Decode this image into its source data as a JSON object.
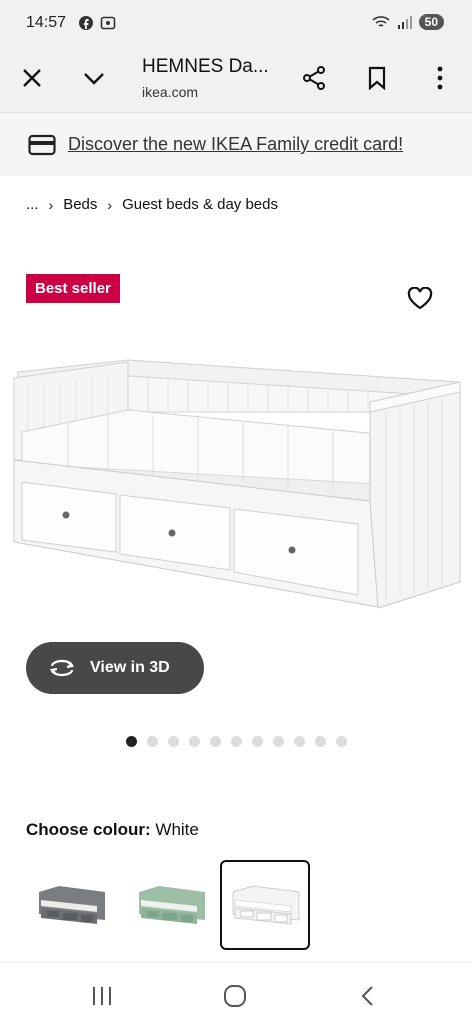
{
  "status": {
    "time": "14:57",
    "battery": "50"
  },
  "browser": {
    "title": "HEMNES Da...",
    "domain": "ikea.com"
  },
  "promo": {
    "text": "Discover the new IKEA Family credit card!"
  },
  "breadcrumb": [
    "...",
    "Beds",
    "Guest beds & day beds"
  ],
  "product": {
    "badge": "Best seller",
    "view3d_label": "View in 3D",
    "image_count": 11,
    "active_image": 1
  },
  "colour": {
    "label": "Choose colour:",
    "value": "White",
    "options": [
      {
        "name": "Grey",
        "color": "#7b7d80"
      },
      {
        "name": "Green",
        "color": "#9cbfa6"
      },
      {
        "name": "White",
        "color": "#f4f4f4",
        "selected": true
      }
    ]
  },
  "colors": {
    "badge": "#cc0044",
    "button": "#484848"
  }
}
